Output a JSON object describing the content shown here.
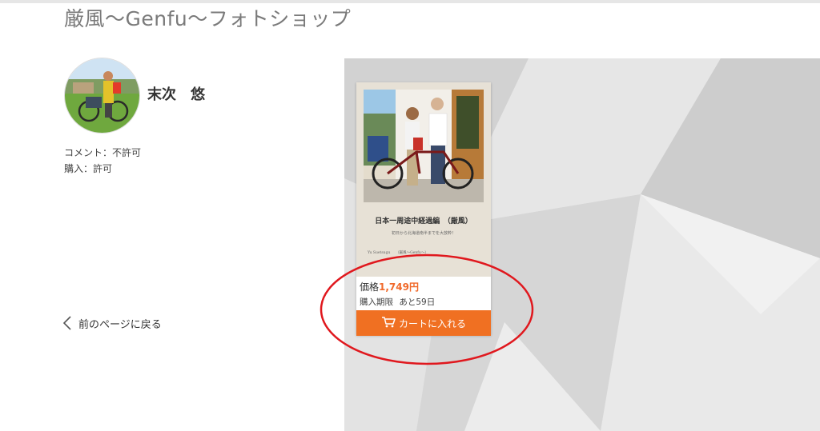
{
  "shop": {
    "title": "厳風〜Genfu〜フォトショップ"
  },
  "author": {
    "name": "末次　悠",
    "comment_permission": "コメント：不許可",
    "purchase_permission": "購入：許可"
  },
  "navigation": {
    "back_label": "前のページに戻る"
  },
  "product": {
    "cover_title": "日本一周途中経過編　（厳風）",
    "cover_subtitle": "初日から北海道南半までを大放粋！",
    "cover_author": "Yu Suetsugu　　（厳風〜Genfu〜）",
    "price_label": "価格",
    "price_value": "1,749円",
    "deadline_label": "購入期限",
    "deadline_value": "あと59日",
    "cart_button_label": "カートに入れる"
  },
  "colors": {
    "accent": "#f07022",
    "price": "#f0692a",
    "annotation": "#e0181e",
    "title": "#7a7a7a"
  },
  "icons": {
    "back": "chevron-left-icon",
    "cart": "cart-icon"
  }
}
